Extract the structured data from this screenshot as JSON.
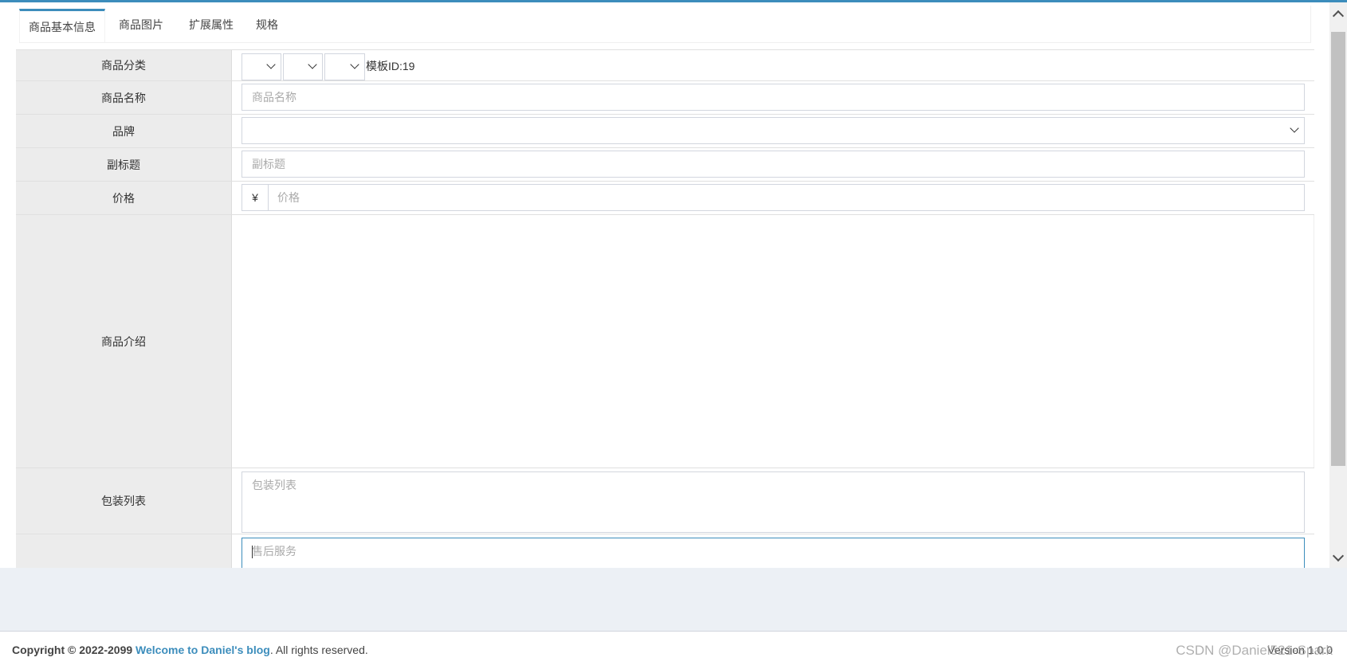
{
  "tabs": [
    {
      "label": "商品基本信息",
      "active": true
    },
    {
      "label": "商品图片",
      "active": false
    },
    {
      "label": "扩展属性",
      "active": false
    },
    {
      "label": "规格",
      "active": false
    }
  ],
  "form": {
    "category": {
      "label": "商品分类",
      "template_text": "模板ID:19"
    },
    "name": {
      "label": "商品名称",
      "placeholder": "商品名称"
    },
    "brand": {
      "label": "品牌",
      "value": ""
    },
    "subtitle": {
      "label": "副标题",
      "placeholder": "副标题"
    },
    "price": {
      "label": "价格",
      "currency": "¥",
      "placeholder": "价格"
    },
    "intro": {
      "label": "商品介绍"
    },
    "package": {
      "label": "包装列表",
      "placeholder": "包装列表"
    },
    "service": {
      "label": "",
      "placeholder": "售后服务"
    }
  },
  "footer": {
    "copyright_prefix": "Copyright © 2022-2099",
    "link_text": "Welcome to Daniel's blog",
    "suffix": ". All rights reserved.",
    "version": "Version 1.0.0",
    "watermark": "CSDN @Daniel521-Spark"
  },
  "colors": {
    "accent": "#3c8dbc",
    "label_bg": "#ececec",
    "page_bg": "#ecf0f5"
  }
}
